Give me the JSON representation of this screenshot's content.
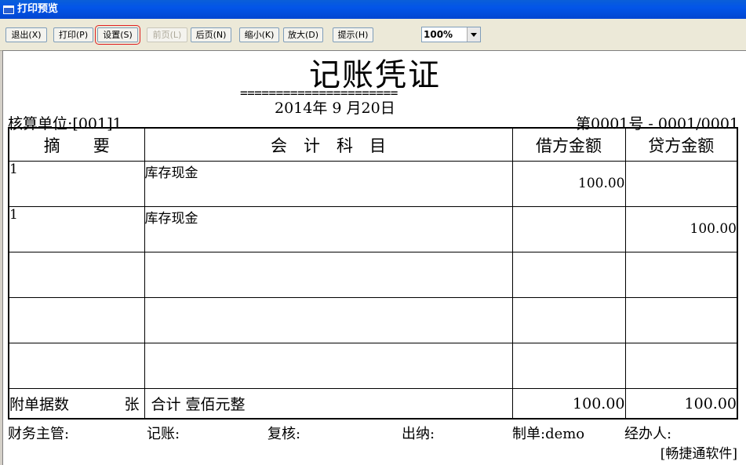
{
  "window": {
    "title": "打印预览"
  },
  "toolbar": {
    "exit": "退出(X)",
    "print": "打印(P)",
    "setup": "设置(S)",
    "prev": "前页(L)",
    "next": "后页(N)",
    "zoom_out": "缩小(K)",
    "zoom_in": "放大(D)",
    "hint": "提示(H)",
    "zoom_value": "100%"
  },
  "voucher": {
    "title": "记账凭证",
    "title_underline": "======================",
    "date": "2014年 9 月20日",
    "unit": "核算单位:[001]1",
    "number": "第0001号 - 0001/0001",
    "headers": {
      "summary": "摘　　要",
      "account": "会　计　科　目",
      "debit": "借方金额",
      "credit": "贷方金额"
    },
    "rows": [
      {
        "summary": "1",
        "account": "库存现金",
        "debit": "100.00",
        "credit": ""
      },
      {
        "summary": "1",
        "account": "库存现金",
        "debit": "",
        "credit": "100.00"
      },
      {
        "summary": "",
        "account": "",
        "debit": "",
        "credit": ""
      },
      {
        "summary": "",
        "account": "",
        "debit": "",
        "credit": ""
      },
      {
        "summary": "",
        "account": "",
        "debit": "",
        "credit": ""
      }
    ],
    "attachments_label": "附单据数",
    "attachments_unit": "张",
    "total_label": "合计 壹佰元整",
    "total_debit": "100.00",
    "total_credit": "100.00",
    "footer": {
      "supervisor": "财务主管:",
      "bookkeeper": "记账:",
      "reviewer": "复核:",
      "cashier": "出纳:",
      "preparer": "制单:demo",
      "handler": "经办人:"
    },
    "brand": "[畅捷通软件]"
  }
}
